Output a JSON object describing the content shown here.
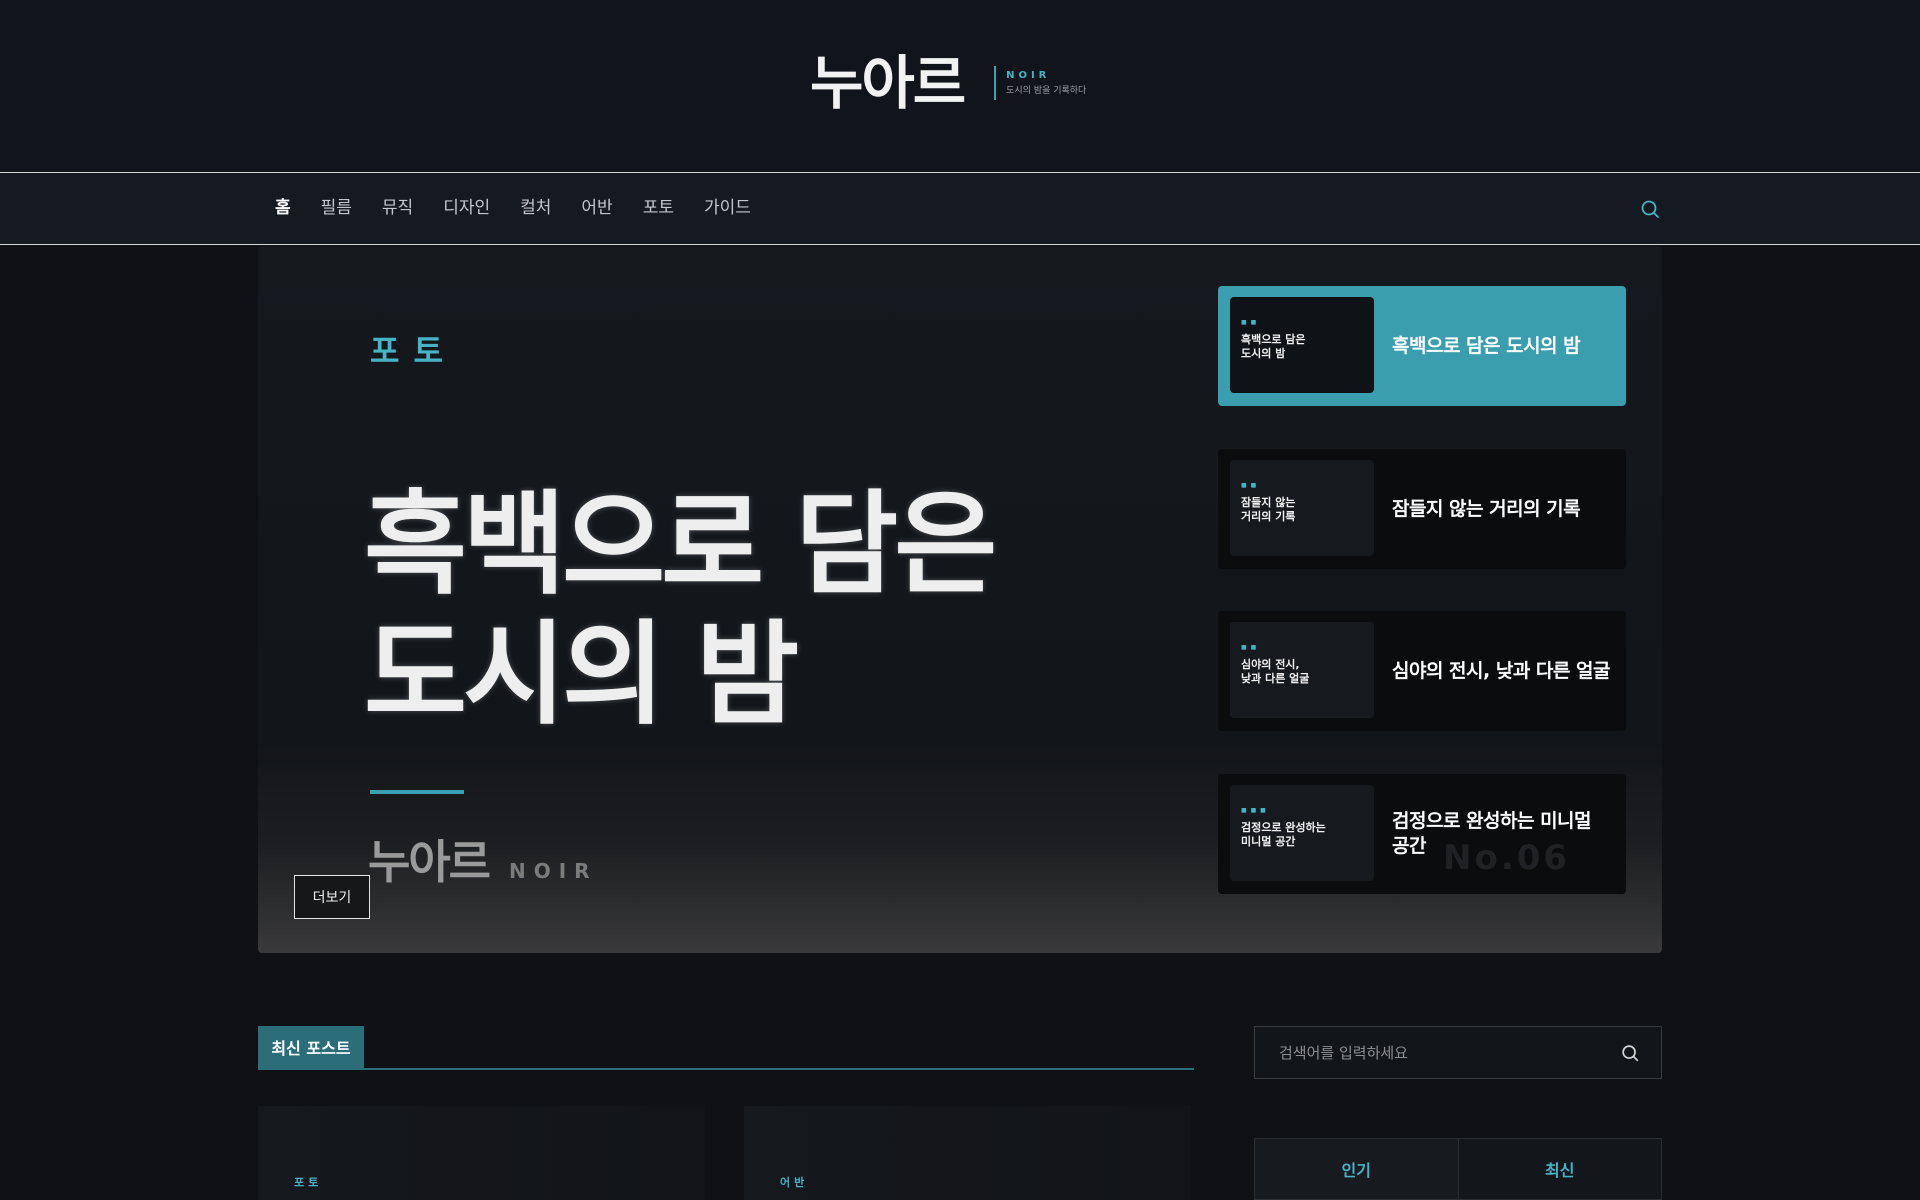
{
  "header": {
    "logo": "누아르",
    "logo_en": "NOIR",
    "tagline": "도시의 밤을 기록하다"
  },
  "nav": {
    "items": [
      "홈",
      "필름",
      "뮤직",
      "디자인",
      "컬처",
      "어반",
      "포토",
      "가이드"
    ],
    "active_index": 0
  },
  "hero": {
    "category": "포토",
    "title_line1": "흑백으로 담은",
    "title_line2": "도시의 밤",
    "brand": "누아르",
    "brand_en": "NOIR",
    "more_label": "더보기",
    "ghost_number": "No.06",
    "slides": [
      {
        "title": "흑백으로 담은 도시의 밤",
        "thumb_line1": "흑백으로 담은",
        "thumb_line2": "도시의 밤",
        "active": true
      },
      {
        "title": "잠들지 않는 거리의 기록",
        "thumb_line1": "잠들지 않는",
        "thumb_line2": "거리의 기록",
        "active": false
      },
      {
        "title": "심야의 전시, 낮과 다른 얼굴",
        "thumb_line1": "심야의 전시,",
        "thumb_line2": "낮과 다른 얼굴",
        "active": false
      },
      {
        "title": "검정으로 완성하는 미니멀 공간",
        "thumb_line1": "검정으로 완성하는",
        "thumb_line2": "미니멀 공간",
        "active": false
      }
    ]
  },
  "recent": {
    "label": "최신 포스트",
    "posts": [
      {
        "category": "포토"
      },
      {
        "category": "어반"
      }
    ]
  },
  "sidebar": {
    "search_placeholder": "검색어를 입력하세요",
    "tabs": [
      "인기",
      "최신"
    ]
  },
  "colors": {
    "accent": "#3b9eae",
    "background": "#0f1115"
  }
}
